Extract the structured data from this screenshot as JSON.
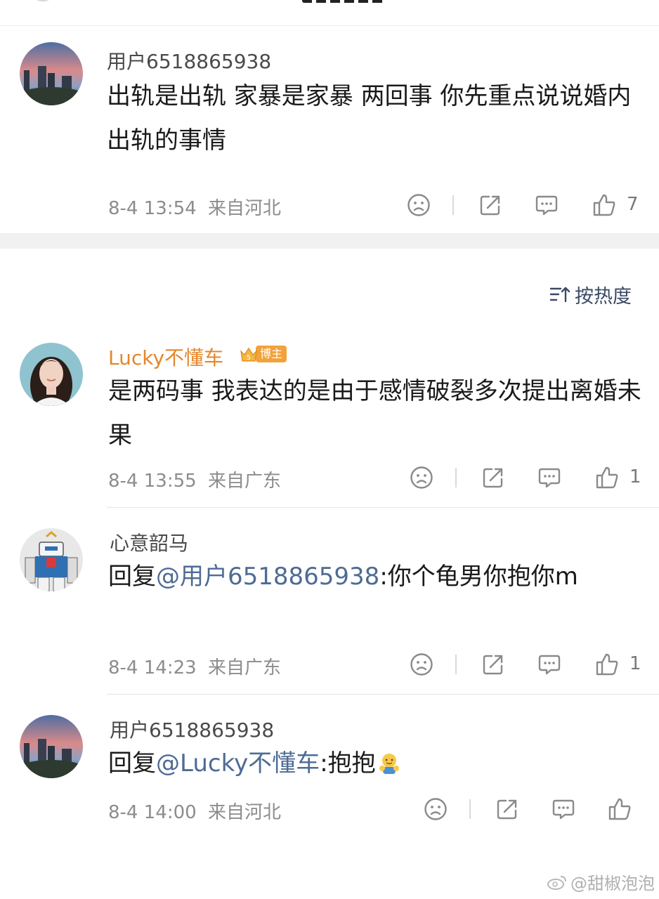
{
  "comments_top": [
    {
      "username": "用户6518865938",
      "text": "出轨是出轨 家暴是家暴 两回事 你先重点说说婚内出轨的事情",
      "time": "8-4 13:54",
      "location": "来自河北",
      "likes": "7"
    }
  ],
  "sort": {
    "label": "按热度",
    "icon": "sort-icon"
  },
  "main_comment": {
    "username": "Lucky不懂车",
    "badge_label": "博主",
    "badge_level": "5",
    "text": "是两码事 我表达的是由于感情破裂多次提出离婚未果",
    "time": "8-4 13:55",
    "location": "来自广东",
    "likes": "1"
  },
  "replies": [
    {
      "username": "心意韶马",
      "prefix": "回复",
      "mention": "@用户6518865938",
      "text": ":你个龟男你抱你m",
      "time": "8-4 14:23",
      "location": "来自广东",
      "likes": "1"
    },
    {
      "username": "用户6518865938",
      "prefix": "回复",
      "mention": "@Lucky不懂车",
      "text": ":抱抱",
      "emoji": "hug-emoji",
      "time": "8-4 14:00",
      "location": "来自河北",
      "likes": ""
    }
  ],
  "watermark": "@甜椒泡泡",
  "colors": {
    "username_highlight": "#e5862a",
    "mention": "#4e6b94",
    "badge": "#f2a23a",
    "meta": "#8c8c8c"
  }
}
